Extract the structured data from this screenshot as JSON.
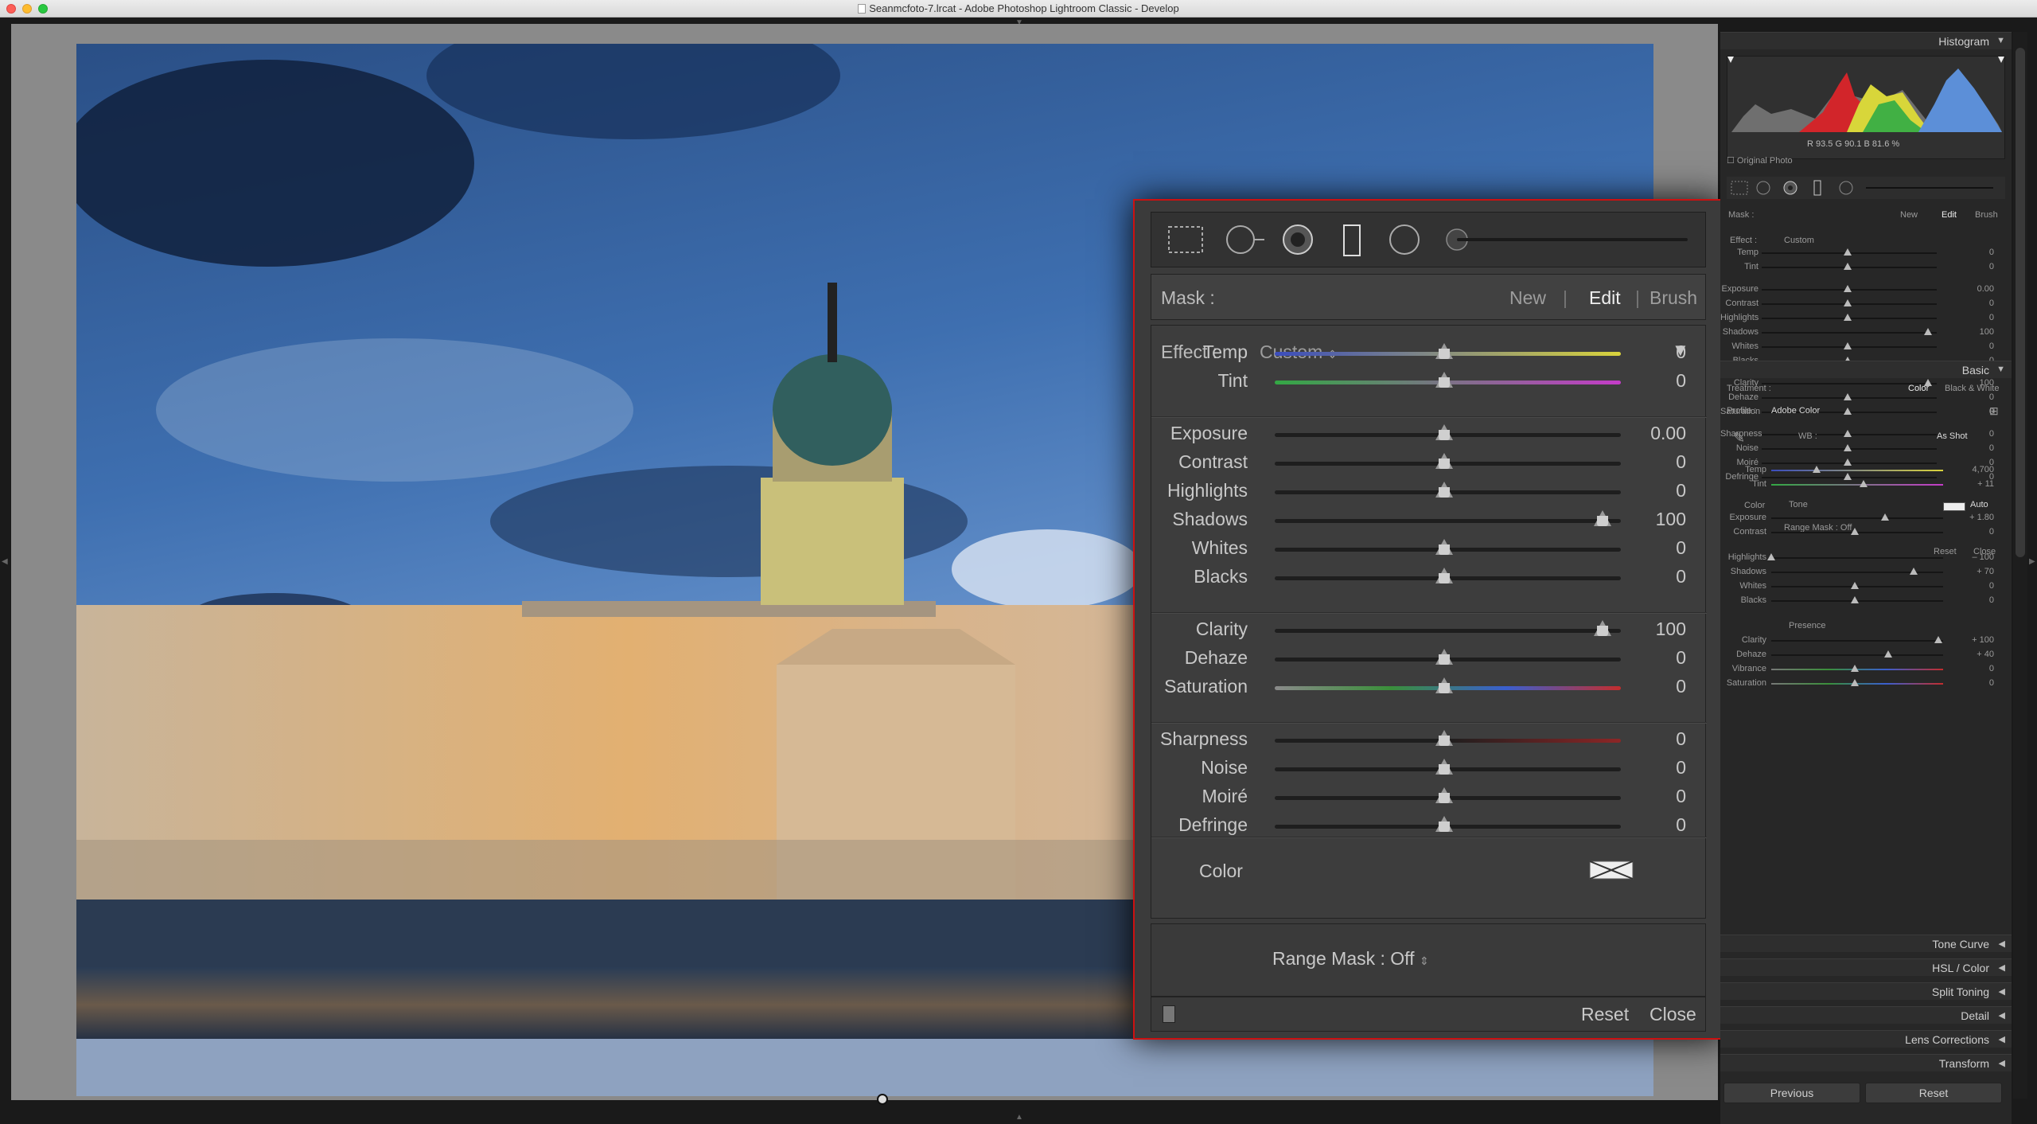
{
  "window": {
    "title": "Seanmcfoto-7.lrcat - Adobe Photoshop Lightroom Classic - Develop"
  },
  "zoom_panel": {
    "mask_label": "Mask :",
    "mask_tabs": [
      "New",
      "Edit",
      "Brush"
    ],
    "active_tab": "Edit",
    "effect_label": "Effect :",
    "effect_value": "Custom",
    "groups": [
      [
        {
          "label": "Temp",
          "value": "0",
          "level": 0.5
        },
        {
          "label": "Tint",
          "value": "0",
          "level": 0.5
        }
      ],
      [
        {
          "label": "Exposure",
          "value": "0.00",
          "level": 0.5
        },
        {
          "label": "Contrast",
          "value": "0",
          "level": 0.5
        },
        {
          "label": "Highlights",
          "value": "0",
          "level": 0.5
        },
        {
          "label": "Shadows",
          "value": "100",
          "level": 0.97
        },
        {
          "label": "Whites",
          "value": "0",
          "level": 0.5
        },
        {
          "label": "Blacks",
          "value": "0",
          "level": 0.5
        }
      ],
      [
        {
          "label": "Clarity",
          "value": "100",
          "level": 0.97
        },
        {
          "label": "Dehaze",
          "value": "0",
          "level": 0.5
        },
        {
          "label": "Saturation",
          "value": "0",
          "level": 0.5
        }
      ],
      [
        {
          "label": "Sharpness",
          "value": "0",
          "level": 0.5
        },
        {
          "label": "Noise",
          "value": "0",
          "level": 0.5
        },
        {
          "label": "Moiré",
          "value": "0",
          "level": 0.5
        },
        {
          "label": "Defringe",
          "value": "0",
          "level": 0.5
        }
      ]
    ],
    "color_label": "Color",
    "range_mask": "Range Mask : Off",
    "reset": "Reset",
    "close": "Close"
  },
  "right_panel": {
    "histogram": {
      "title": "Histogram",
      "rgb_readout": "R  93.5  G  90.1  B  81.6 %",
      "original_photo": "Original Photo"
    },
    "mask_mini": {
      "mask_label": "Mask :",
      "tabs": [
        "New",
        "Edit",
        "Brush"
      ],
      "effect_label": "Effect :",
      "effect_value": "Custom",
      "sliders": [
        {
          "label": "Temp",
          "value": "0",
          "level": 0.5
        },
        {
          "label": "Tint",
          "value": "0",
          "level": 0.5
        },
        {
          "label": "Exposure",
          "value": "0.00",
          "level": 0.5
        },
        {
          "label": "Contrast",
          "value": "0",
          "level": 0.5
        },
        {
          "label": "Highlights",
          "value": "0",
          "level": 0.5
        },
        {
          "label": "Shadows",
          "value": "100",
          "level": 0.97
        },
        {
          "label": "Whites",
          "value": "0",
          "level": 0.5
        },
        {
          "label": "Blacks",
          "value": "0",
          "level": 0.5
        },
        {
          "label": "Clarity",
          "value": "100",
          "level": 0.97
        },
        {
          "label": "Dehaze",
          "value": "0",
          "level": 0.5
        },
        {
          "label": "Saturation",
          "value": "0",
          "level": 0.5
        },
        {
          "label": "Sharpness",
          "value": "0",
          "level": 0.5
        },
        {
          "label": "Noise",
          "value": "0",
          "level": 0.5
        },
        {
          "label": "Moiré",
          "value": "0",
          "level": 0.5
        },
        {
          "label": "Defringe",
          "value": "0",
          "level": 0.5
        }
      ],
      "color_label": "Color",
      "range_mask": "Range Mask : Off",
      "reset": "Reset",
      "close": "Close"
    },
    "basic": {
      "title": "Basic",
      "treatment_label": "Treatment :",
      "treatment_options": [
        "Color",
        "Black & White"
      ],
      "profile_label": "Profile :",
      "profile_value": "Adobe Color",
      "wb_label": "WB :",
      "wb_value": "As Shot",
      "tone_label": "Tone",
      "auto_label": "Auto",
      "presence_label": "Presence",
      "sliders": [
        {
          "label": "Temp",
          "value": "4,700",
          "level": 0.27
        },
        {
          "label": "Tint",
          "value": "+ 11",
          "level": 0.55
        },
        {
          "label": "Exposure",
          "value": "+ 1.80",
          "level": 0.68
        },
        {
          "label": "Contrast",
          "value": "0",
          "level": 0.5
        },
        {
          "label": "Highlights",
          "value": "– 100",
          "level": 0.0
        },
        {
          "label": "Shadows",
          "value": "+ 70",
          "level": 0.85
        },
        {
          "label": "Whites",
          "value": "0",
          "level": 0.5
        },
        {
          "label": "Blacks",
          "value": "0",
          "level": 0.5
        },
        {
          "label": "Clarity",
          "value": "+ 100",
          "level": 1.0
        },
        {
          "label": "Dehaze",
          "value": "+ 40",
          "level": 0.7
        },
        {
          "label": "Vibrance",
          "value": "0",
          "level": 0.5
        },
        {
          "label": "Saturation",
          "value": "0",
          "level": 0.5
        }
      ]
    },
    "sections": [
      "Tone Curve",
      "HSL / Color",
      "Split Toning",
      "Detail",
      "Lens Corrections",
      "Transform"
    ],
    "buttons": {
      "previous": "Previous",
      "reset": "Reset"
    }
  },
  "colors": {
    "accent_border": "#cc1111",
    "panel_bg": "#3b3b3b",
    "app_bg": "#272727"
  }
}
